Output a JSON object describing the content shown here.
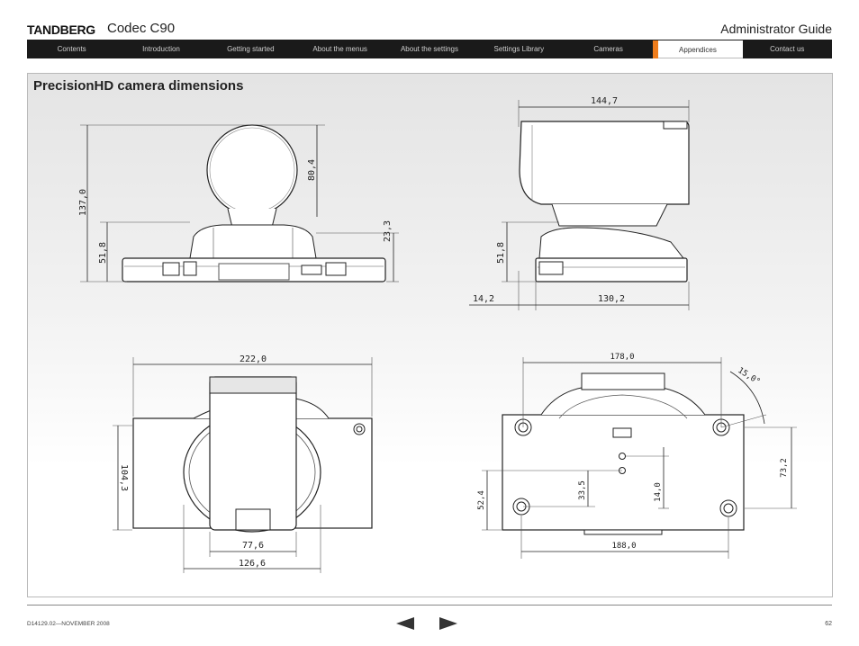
{
  "header": {
    "brand": "TANDBERG",
    "product": "Codec C90",
    "guide": "Administrator Guide"
  },
  "nav": [
    {
      "label": "Contents",
      "active": false
    },
    {
      "label": "Introduction",
      "active": false
    },
    {
      "label": "Getting started",
      "active": false
    },
    {
      "label": "About the menus",
      "active": false
    },
    {
      "label": "About the settings",
      "active": false
    },
    {
      "label": "Settings Library",
      "active": false
    },
    {
      "label": "Cameras",
      "active": false
    },
    {
      "label": "Appendices",
      "active": true
    },
    {
      "label": "Contact us",
      "active": false
    }
  ],
  "page": {
    "title": "PrecisionHD camera dimensions"
  },
  "dimensions": {
    "front": {
      "total_height": "137,0",
      "head_height": "80,4",
      "base_height": "51,8",
      "base_top": "23,3"
    },
    "side": {
      "depth": "144,7",
      "base_height": "51,8",
      "offset": "14,2",
      "base_depth": "130,2"
    },
    "top": {
      "width": "222,0",
      "depth": "104,3",
      "head_width": "77,6",
      "disk_width": "126,6"
    },
    "bottom": {
      "hole_spacing": "178,0",
      "angle": "15,0°",
      "height": "73,2",
      "left_height": "52,4",
      "center_a": "33,5",
      "center_b": "14,0",
      "width": "188,0"
    }
  },
  "footer": {
    "doc_id": "D14129.02—NOVEMBER 2008",
    "page_number": "62"
  }
}
